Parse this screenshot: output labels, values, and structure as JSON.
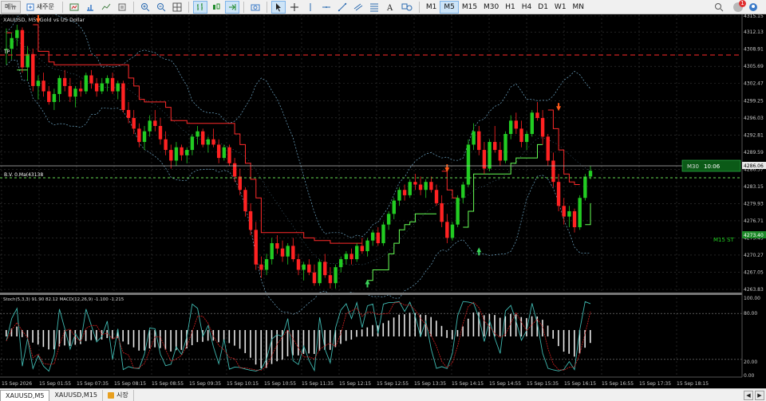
{
  "toolbar": {
    "menu_left": "메뉴",
    "new_order": "새주문",
    "timeframes": [
      "M1",
      "M5",
      "M15",
      "M30",
      "H1",
      "H4",
      "D1",
      "W1",
      "MN"
    ],
    "active_timeframe": "M5",
    "notification_count": "1"
  },
  "chart": {
    "title": "XAUUSD, M5: Gold vs US Dollar",
    "tp_label": "TP",
    "bid_line_label": "B.V. 0.Ma(43138",
    "m30_label": "M30",
    "m30_countdown": "10:06",
    "m15_label": "M15 ST",
    "current_price": "4286.06",
    "m15_price": "4273.40"
  },
  "indicator": {
    "title": "Stoch(5,3,3) 91.90 82.12  MACD(12,26,9) -1.100 -1.215",
    "levels": [
      "100.00",
      "80.00",
      "20.00",
      "0.00"
    ]
  },
  "price_axis": [
    "4315.15",
    "4312.13",
    "4308.91",
    "4305.69",
    "4302.47",
    "4299.25",
    "4296.03",
    "4292.81",
    "4289.59",
    "4286.37",
    "4283.15",
    "4279.93",
    "4276.71",
    "4273.49",
    "4270.27",
    "4267.05",
    "4263.83"
  ],
  "time_axis": [
    "15 Sep 2026",
    "15 Sep 01:55",
    "15 Sep 07:35",
    "15 Sep 08:15",
    "15 Sep 08:55",
    "15 Sep 09:35",
    "15 Sep 10:15",
    "15 Sep 10:55",
    "15 Sep 11:35",
    "15 Sep 12:15",
    "15 Sep 12:55",
    "15 Sep 13:35",
    "15 Sep 14:15",
    "15 Sep 14:55",
    "15 Sep 15:35",
    "15 Sep 16:15",
    "15 Sep 16:55",
    "15 Sep 17:35",
    "15 Sep 18:15"
  ],
  "tabs": [
    "XAUUSD,M5",
    "XAUUSD,M15",
    "시장"
  ],
  "colors": {
    "bull": "#22cc22",
    "bear": "#ff2222",
    "grid": "#3a3a3a",
    "band": "#6fa8c8",
    "supertrend_down": "#ff2a2a",
    "supertrend_up": "#66ff55",
    "signal_arrow_up": "#3ad45a",
    "signal_arrow_down": "#ff5a1a"
  },
  "chart_data": {
    "type": "candlestick",
    "symbol": "XAUUSD",
    "timeframe": "M5",
    "ylim": [
      4263.83,
      4315.15
    ],
    "candles": [
      [
        4308.9,
        4312.8,
        4306.0,
        4309.0
      ],
      [
        4309.0,
        4312.0,
        4307.0,
        4311.0
      ],
      [
        4311.0,
        4313.5,
        4309.5,
        4312.5
      ],
      [
        4312.5,
        4313.0,
        4304.5,
        4305.5
      ],
      [
        4305.5,
        4309.5,
        4303.0,
        4308.0
      ],
      [
        4308.0,
        4309.0,
        4301.0,
        4302.0
      ],
      [
        4302.0,
        4304.0,
        4299.5,
        4303.0
      ],
      [
        4303.0,
        4304.5,
        4300.0,
        4301.0
      ],
      [
        4301.0,
        4302.0,
        4298.5,
        4299.0
      ],
      [
        4299.0,
        4301.5,
        4297.5,
        4300.5
      ],
      [
        4300.5,
        4304.0,
        4299.0,
        4303.5
      ],
      [
        4303.5,
        4305.0,
        4301.0,
        4302.0
      ],
      [
        4302.0,
        4303.5,
        4299.0,
        4300.0
      ],
      [
        4300.0,
        4302.0,
        4298.0,
        4301.5
      ],
      [
        4301.5,
        4303.0,
        4300.0,
        4301.0
      ],
      [
        4301.0,
        4304.5,
        4300.5,
        4304.0
      ],
      [
        4304.0,
        4305.0,
        4301.5,
        4302.5
      ],
      [
        4302.5,
        4303.5,
        4300.0,
        4301.0
      ],
      [
        4301.0,
        4303.5,
        4300.5,
        4302.5
      ],
      [
        4302.5,
        4304.0,
        4301.0,
        4303.5
      ],
      [
        4303.5,
        4304.5,
        4300.5,
        4301.0
      ],
      [
        4301.0,
        4303.0,
        4299.5,
        4302.5
      ],
      [
        4302.5,
        4303.0,
        4297.0,
        4297.5
      ],
      [
        4297.5,
        4299.0,
        4295.0,
        4296.0
      ],
      [
        4296.0,
        4297.5,
        4293.0,
        4294.0
      ],
      [
        4294.0,
        4295.0,
        4290.5,
        4291.5
      ],
      [
        4291.5,
        4294.5,
        4290.0,
        4293.5
      ],
      [
        4293.5,
        4296.5,
        4292.5,
        4295.5
      ],
      [
        4295.5,
        4297.5,
        4293.5,
        4294.5
      ],
      [
        4294.5,
        4296.0,
        4291.0,
        4292.0
      ],
      [
        4292.0,
        4293.5,
        4289.0,
        4290.0
      ],
      [
        4290.0,
        4291.0,
        4286.5,
        4288.0
      ],
      [
        4288.0,
        4291.5,
        4287.0,
        4290.5
      ],
      [
        4290.5,
        4291.0,
        4288.0,
        4289.0
      ],
      [
        4289.0,
        4290.5,
        4287.5,
        4290.0
      ],
      [
        4290.0,
        4293.0,
        4289.0,
        4292.5
      ],
      [
        4292.5,
        4294.5,
        4291.0,
        4293.5
      ],
      [
        4293.5,
        4294.0,
        4290.5,
        4291.0
      ],
      [
        4291.0,
        4292.5,
        4289.5,
        4292.0
      ],
      [
        4292.0,
        4294.0,
        4290.5,
        4291.0
      ],
      [
        4291.0,
        4292.0,
        4287.5,
        4288.5
      ],
      [
        4288.5,
        4291.0,
        4288.0,
        4290.5
      ],
      [
        4290.5,
        4291.0,
        4287.0,
        4287.5
      ],
      [
        4287.5,
        4288.5,
        4284.0,
        4285.0
      ],
      [
        4285.0,
        4286.5,
        4281.5,
        4282.5
      ],
      [
        4282.5,
        4283.0,
        4277.5,
        4278.5
      ],
      [
        4278.5,
        4280.0,
        4274.0,
        4275.0
      ],
      [
        4275.0,
        4276.5,
        4267.5,
        4268.5
      ],
      [
        4268.5,
        4270.0,
        4266.0,
        4267.5
      ],
      [
        4267.5,
        4270.5,
        4266.5,
        4269.5
      ],
      [
        4269.5,
        4273.5,
        4268.5,
        4272.5
      ],
      [
        4272.5,
        4274.0,
        4270.5,
        4271.5
      ],
      [
        4271.5,
        4273.0,
        4269.0,
        4270.0
      ],
      [
        4270.0,
        4272.5,
        4268.5,
        4272.0
      ],
      [
        4272.0,
        4273.5,
        4269.0,
        4269.5
      ],
      [
        4269.5,
        4270.5,
        4266.5,
        4267.5
      ],
      [
        4267.5,
        4269.0,
        4265.5,
        4268.5
      ],
      [
        4268.5,
        4269.5,
        4266.5,
        4267.0
      ],
      [
        4267.0,
        4268.5,
        4264.5,
        4265.0
      ],
      [
        4265.0,
        4269.5,
        4264.5,
        4269.0
      ],
      [
        4269.0,
        4270.5,
        4266.0,
        4266.5
      ],
      [
        4266.5,
        4268.0,
        4264.0,
        4265.0
      ],
      [
        4265.0,
        4268.5,
        4264.0,
        4268.0
      ],
      [
        4268.0,
        4270.0,
        4267.0,
        4269.5
      ],
      [
        4269.5,
        4271.0,
        4268.5,
        4270.5
      ],
      [
        4270.5,
        4271.5,
        4268.5,
        4269.5
      ],
      [
        4269.5,
        4272.5,
        4269.0,
        4272.0
      ],
      [
        4272.0,
        4273.5,
        4270.5,
        4271.0
      ],
      [
        4271.0,
        4273.5,
        4270.0,
        4273.0
      ],
      [
        4273.0,
        4275.0,
        4272.0,
        4274.5
      ],
      [
        4274.5,
        4275.5,
        4272.0,
        4272.5
      ],
      [
        4272.5,
        4276.5,
        4272.0,
        4276.0
      ],
      [
        4276.0,
        4278.5,
        4275.0,
        4278.0
      ],
      [
        4278.0,
        4281.0,
        4277.0,
        4280.5
      ],
      [
        4280.5,
        4283.0,
        4279.5,
        4282.5
      ],
      [
        4282.5,
        4283.5,
        4280.5,
        4281.5
      ],
      [
        4281.5,
        4284.5,
        4281.0,
        4284.0
      ],
      [
        4284.0,
        4285.5,
        4282.5,
        4283.5
      ],
      [
        4283.5,
        4285.0,
        4281.5,
        4282.5
      ],
      [
        4282.5,
        4284.5,
        4281.0,
        4284.0
      ],
      [
        4284.0,
        4285.0,
        4282.0,
        4282.5
      ],
      [
        4282.5,
        4283.5,
        4279.5,
        4280.0
      ],
      [
        4280.0,
        4281.5,
        4275.5,
        4276.5
      ],
      [
        4276.5,
        4278.0,
        4272.5,
        4273.5
      ],
      [
        4273.5,
        4276.5,
        4273.0,
        4276.0
      ],
      [
        4276.0,
        4281.5,
        4275.5,
        4281.0
      ],
      [
        4281.0,
        4284.0,
        4280.0,
        4283.5
      ],
      [
        4283.5,
        4292.0,
        4283.0,
        4291.0
      ],
      [
        4291.0,
        4295.0,
        4290.0,
        4293.5
      ],
      [
        4293.5,
        4294.5,
        4289.0,
        4290.0
      ],
      [
        4290.0,
        4291.5,
        4285.5,
        4286.5
      ],
      [
        4286.5,
        4292.0,
        4286.0,
        4291.5
      ],
      [
        4291.5,
        4294.5,
        4289.5,
        4290.0
      ],
      [
        4290.0,
        4291.5,
        4287.0,
        4288.0
      ],
      [
        4288.0,
        4293.5,
        4287.5,
        4293.0
      ],
      [
        4293.0,
        4296.5,
        4292.0,
        4295.5
      ],
      [
        4295.5,
        4297.0,
        4293.0,
        4294.0
      ],
      [
        4294.0,
        4295.5,
        4290.5,
        4291.5
      ],
      [
        4291.5,
        4293.5,
        4290.0,
        4293.0
      ],
      [
        4293.0,
        4297.5,
        4292.5,
        4297.0
      ],
      [
        4297.0,
        4299.0,
        4295.5,
        4296.0
      ],
      [
        4296.0,
        4297.5,
        4291.0,
        4292.5
      ],
      [
        4292.5,
        4293.0,
        4287.0,
        4288.0
      ],
      [
        4288.0,
        4289.5,
        4283.0,
        4284.0
      ],
      [
        4284.0,
        4285.5,
        4278.5,
        4279.5
      ],
      [
        4279.5,
        4281.0,
        4276.0,
        4277.5
      ],
      [
        4277.5,
        4279.5,
        4275.5,
        4278.5
      ],
      [
        4278.5,
        4279.0,
        4274.5,
        4275.5
      ],
      [
        4275.5,
        4281.5,
        4275.0,
        4281.0
      ],
      [
        4281.0,
        4285.5,
        4280.5,
        4285.0
      ],
      [
        4285.0,
        4287.0,
        4284.5,
        4286.1
      ]
    ]
  }
}
